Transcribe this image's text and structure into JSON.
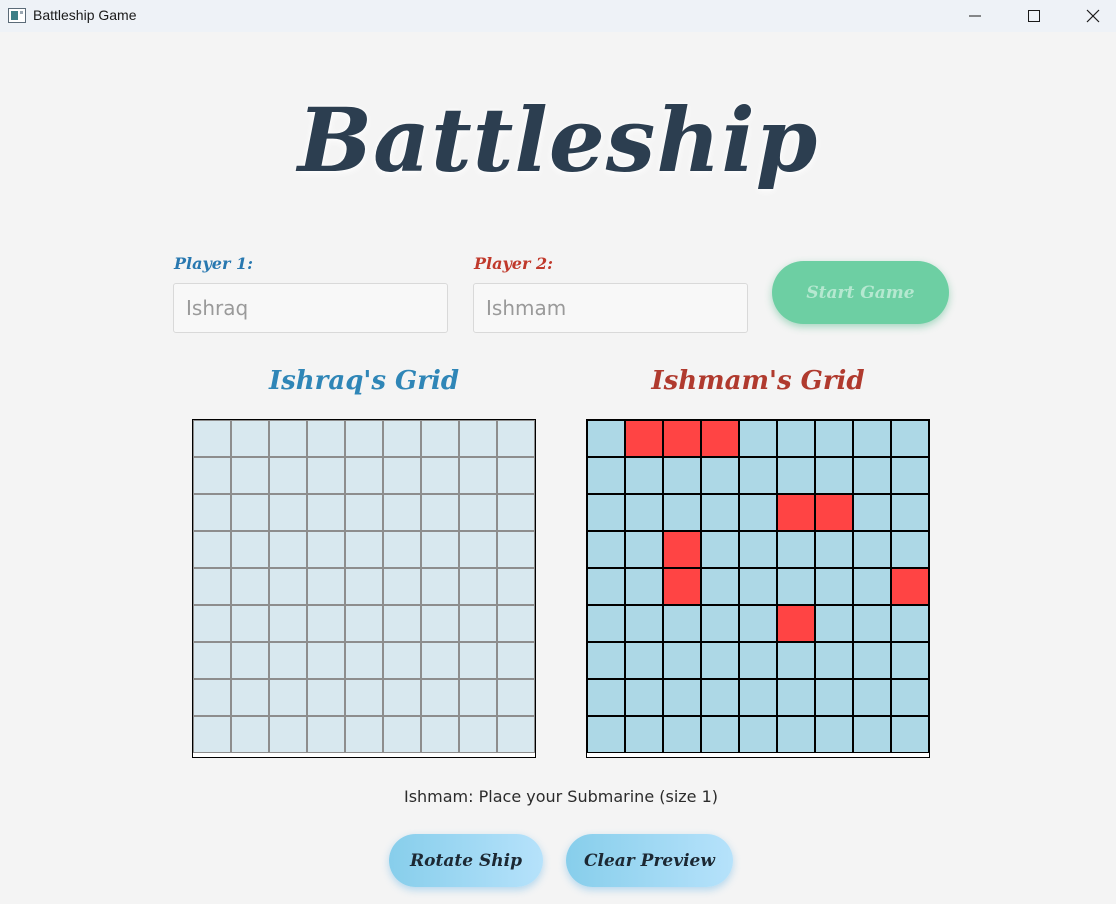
{
  "window": {
    "title": "Battleship Game"
  },
  "heading": "Battleship",
  "players": {
    "p1_label": "Player 1:",
    "p1_value": "Ishraq",
    "p2_label": "Player 2:",
    "p2_value": "Ishmam"
  },
  "start_button": "Start Game",
  "grids": {
    "left_title": "Ishraq's Grid",
    "right_title": "Ishmam's Grid",
    "rows": 9,
    "cols": 9,
    "right_ship_cells": [
      [
        0,
        1
      ],
      [
        0,
        2
      ],
      [
        0,
        3
      ],
      [
        2,
        5
      ],
      [
        2,
        6
      ],
      [
        3,
        2
      ],
      [
        4,
        2
      ],
      [
        4,
        8
      ],
      [
        5,
        5
      ]
    ]
  },
  "status": "Ishmam: Place your Submarine (size 1)",
  "buttons": {
    "rotate": "Rotate Ship",
    "clear": "Clear Preview"
  },
  "colors": {
    "left_cell": "#d8e8ef",
    "right_cell": "#add8e6",
    "ship": "#ff4444",
    "heading": "#2c3e50",
    "player1": "#2878b0",
    "player2": "#c0392b"
  }
}
